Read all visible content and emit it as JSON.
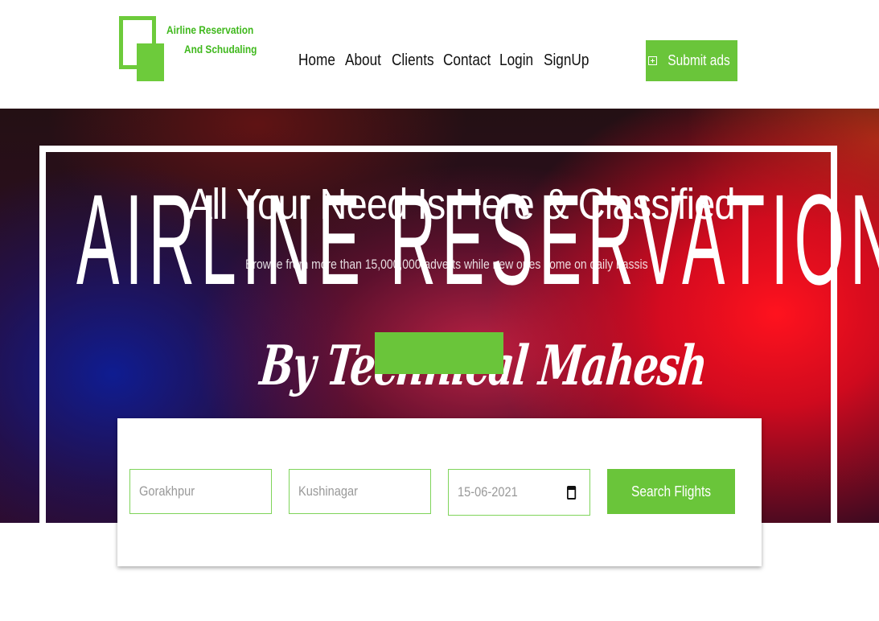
{
  "brand": {
    "line1": "Airline Reservation",
    "line2": "And Schudaling",
    "accent_color": "#6ac53a",
    "logo_icon": "overlapping-squares-logo"
  },
  "nav": {
    "items": [
      {
        "label": "Home"
      },
      {
        "label": "About"
      },
      {
        "label": "Clients"
      },
      {
        "label": "Contact"
      },
      {
        "label": "Login"
      },
      {
        "label": "SignUp"
      }
    ]
  },
  "header": {
    "submit_label": "Submit ads",
    "submit_icon": "plus-square-icon"
  },
  "hero": {
    "background_title": "AIRLINE RESERVATIONS",
    "headline": "All Your Need Is Here & Classified",
    "subline": "Browse from more than 15,000,000 adverts while new ones come on daily bassis",
    "script_text": "By Technical Mahesh"
  },
  "search": {
    "from_placeholder": "Gorakhpur",
    "to_placeholder": "Kushinagar",
    "date_value": "15-06-2021",
    "date_icon": "calendar-icon",
    "button_label": "Search Flights"
  }
}
